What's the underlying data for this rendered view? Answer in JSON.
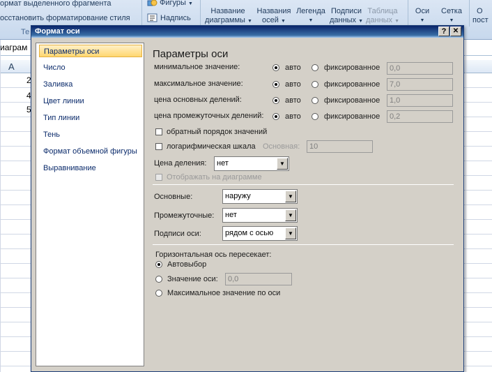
{
  "ribbon": {
    "format_selection": "ормат выделенного фрагмента",
    "reset_style": "осстановить форматирование стиля",
    "group_label_partial": "Те",
    "shapes": "Фигуры",
    "textbox": "Надпись",
    "chart_title": [
      "Название",
      "диаграммы"
    ],
    "axis_titles": [
      "Названия",
      "осей"
    ],
    "legend": "Легенда",
    "data_labels": [
      "Подписи",
      "данных"
    ],
    "data_table": [
      "Таблица",
      "данных"
    ],
    "axes": "Оси",
    "gridlines": "Сетка",
    "plot_area_partial": [
      "О",
      "пост"
    ]
  },
  "sheet": {
    "name_box_partial": "иаграм",
    "column_a": "A",
    "cell_fragments": [
      "2",
      "4",
      "5"
    ]
  },
  "dialog": {
    "title": "Формат оси",
    "help_label": "?",
    "close_label": "✕",
    "nav_items": [
      "Параметры оси",
      "Число",
      "Заливка",
      "Цвет линии",
      "Тип линии",
      "Тень",
      "Формат объемной фигуры",
      "Выравнивание"
    ],
    "panel_title": "Параметры оси",
    "rows": [
      {
        "label": "минимальное значение:",
        "auto": "авто",
        "fixed": "фиксированное",
        "value": "0,0"
      },
      {
        "label": "максимальное значение:",
        "auto": "авто",
        "fixed": "фиксированное",
        "value": "7,0"
      },
      {
        "label": "цена основных делений:",
        "auto": "авто",
        "fixed": "фиксированное",
        "value": "1,0"
      },
      {
        "label": "цена промежуточных делений:",
        "auto": "авто",
        "fixed": "фиксированное",
        "value": "0,2"
      }
    ],
    "reverse_order": "обратный порядок значений",
    "log_scale": "логарифмическая шкала",
    "log_base_label": "Основная:",
    "log_base_value": "10",
    "display_units_label": "Цена деления:",
    "display_units_value": "нет",
    "show_on_chart": "Отображать на диаграмме",
    "major_tick_label": "Основные:",
    "major_tick_value": "наружу",
    "minor_tick_label": "Промежуточные:",
    "minor_tick_value": "нет",
    "axis_labels_label": "Подписи оси:",
    "axis_labels_value": "рядом с осью",
    "crosses_label": "Горизонтальная ось пересекает:",
    "crosses_auto": "Автовыбор",
    "crosses_value_label": "Значение оси:",
    "crosses_value": "0,0",
    "crosses_max": "Максимальное значение по оси"
  }
}
